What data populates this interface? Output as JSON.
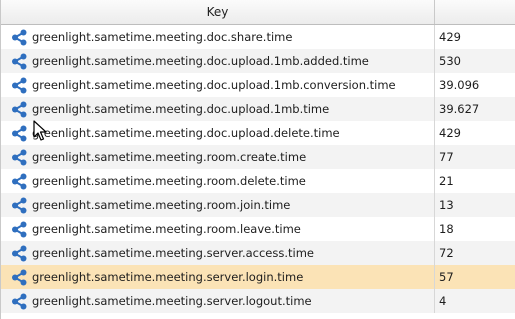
{
  "header": {
    "key_label": "Key",
    "value_label": ""
  },
  "rows": [
    {
      "key": "greenlight.sametime.meeting.doc.share.time",
      "value": "429"
    },
    {
      "key": "greenlight.sametime.meeting.doc.upload.1mb.added.time",
      "value": "530"
    },
    {
      "key": "greenlight.sametime.meeting.doc.upload.1mb.conversion.time",
      "value": "39.096"
    },
    {
      "key": "greenlight.sametime.meeting.doc.upload.1mb.time",
      "value": "39.627"
    },
    {
      "key": "greenlight.sametime.meeting.doc.upload.delete.time",
      "value": "429"
    },
    {
      "key": "greenlight.sametime.meeting.room.create.time",
      "value": "77"
    },
    {
      "key": "greenlight.sametime.meeting.room.delete.time",
      "value": "21"
    },
    {
      "key": "greenlight.sametime.meeting.room.join.time",
      "value": "13"
    },
    {
      "key": "greenlight.sametime.meeting.room.leave.time",
      "value": "18"
    },
    {
      "key": "greenlight.sametime.meeting.server.access.time",
      "value": "72"
    },
    {
      "key": "greenlight.sametime.meeting.server.login.time",
      "value": "57"
    },
    {
      "key": "greenlight.sametime.meeting.server.logout.time",
      "value": "4"
    }
  ],
  "selected_row_index": 10,
  "row_icon": "share-icon",
  "colors": {
    "icon_blue": "#2f6fbf",
    "selected_row": "#fbe3b6",
    "alt_row": "#f3f3f3"
  }
}
